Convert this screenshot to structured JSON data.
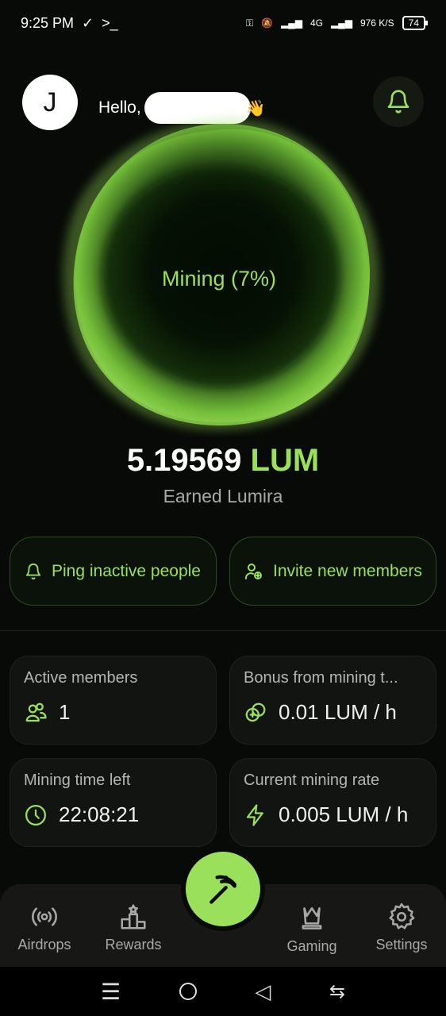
{
  "status_bar": {
    "time": "9:25 PM",
    "network": "4G",
    "speed": "976 K/S",
    "battery": "74"
  },
  "header": {
    "avatar_letter": "J",
    "greeting": "Hello,",
    "wave_emoji": "👋"
  },
  "mining": {
    "status_label": "Mining (7%)",
    "progress_percent": 7,
    "earned_amount": "5.19569",
    "earned_unit": "LUM",
    "earned_caption": "Earned Lumira"
  },
  "actions": {
    "ping_label": "Ping inactive people",
    "invite_label": "Invite new members"
  },
  "stats": [
    {
      "title": "Active members",
      "value": "1",
      "icon": "users-icon"
    },
    {
      "title": "Bonus from mining t...",
      "value": "0.01 LUM / h",
      "icon": "coins-icon"
    },
    {
      "title": "Mining time left",
      "value": "22:08:21",
      "icon": "clock-icon"
    },
    {
      "title": "Current mining rate",
      "value": "0.005 LUM / h",
      "icon": "bolt-icon"
    }
  ],
  "nav": {
    "airdrops": "Airdrops",
    "rewards": "Rewards",
    "gaming": "Gaming",
    "settings": "Settings"
  },
  "colors": {
    "accent": "#9be05a",
    "background": "#070a06",
    "card": "#121412"
  }
}
